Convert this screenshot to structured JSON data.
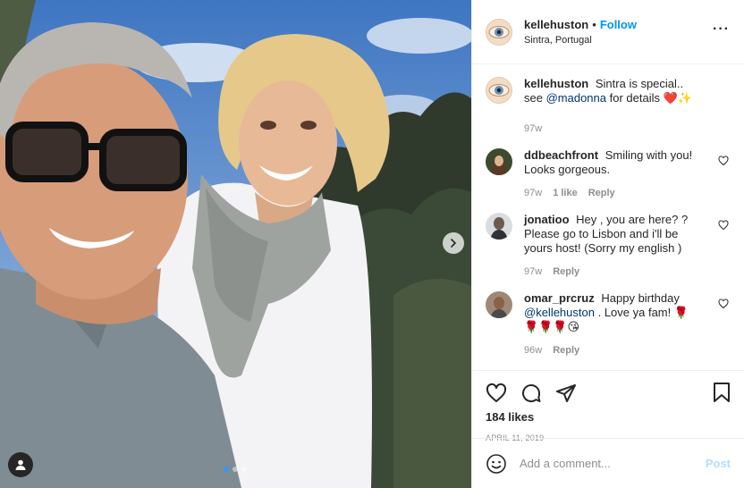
{
  "post": {
    "username": "kellehuston",
    "follow_label": "Follow",
    "separator": "•",
    "location": "Sintra, Portugal",
    "more_icon": "more-horizontal-icon",
    "carousel": {
      "total_slides": 3,
      "active_slide": 1
    }
  },
  "caption": {
    "username": "kellehuston",
    "text_before": "Sintra is special.. see",
    "mention": "@madonna",
    "text_after": "for details ❤️✨",
    "time": "97w"
  },
  "comments": [
    {
      "username": "ddbeachfront",
      "text": "Smiling with you! Looks gorgeous.",
      "time": "97w",
      "likes": "1 like",
      "reply": "Reply"
    },
    {
      "username": "jonatioo",
      "text": "Hey , you are here? ? Please go to Lisbon and i'll be yours host! (Sorry my english )",
      "time": "97w",
      "reply": "Reply"
    },
    {
      "username": "omar_prcruz",
      "text_before": "Happy birthday",
      "mention": "@kellehuston",
      "text_after": ". Love ya fam! 🌹🌹🌹🌹😘",
      "time": "96w",
      "reply": "Reply"
    }
  ],
  "actions": {
    "like_icon": "heart-icon",
    "comment_icon": "comment-icon",
    "share_icon": "paper-plane-icon",
    "save_icon": "bookmark-icon",
    "likes": "184 likes",
    "date": "APRIL 11, 2019"
  },
  "add_comment": {
    "emoji_icon": "smiley-icon",
    "placeholder": "Add a comment...",
    "post_label": "Post"
  },
  "colors": {
    "link_blue": "#0095f6",
    "mention": "#00376b",
    "muted": "#8e8e8e",
    "post_disabled": "#b2dffc",
    "dot_active": "#3897f0"
  }
}
